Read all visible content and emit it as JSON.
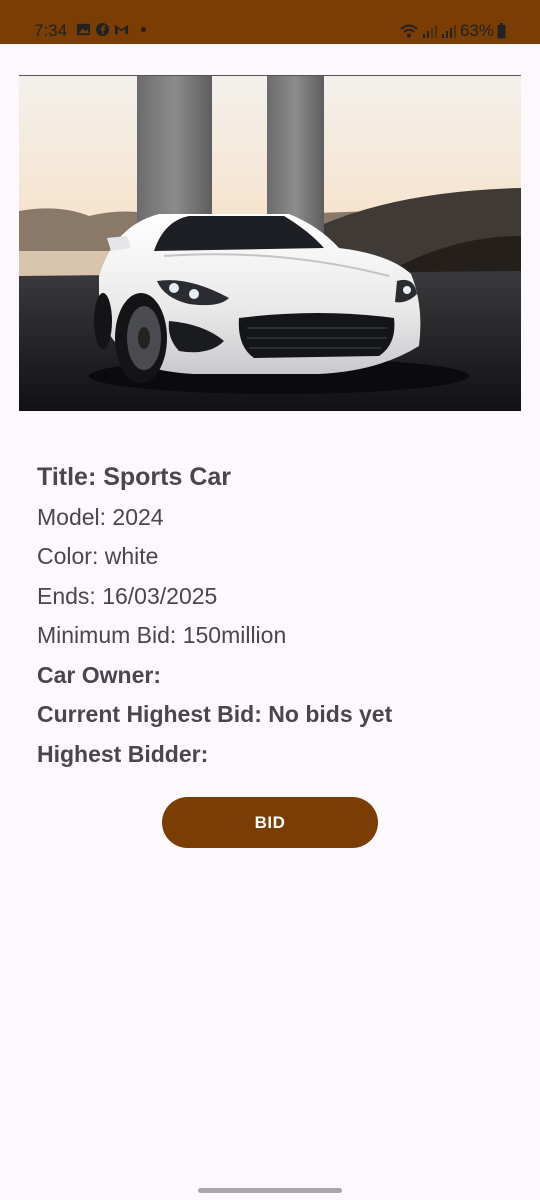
{
  "status_bar": {
    "time": "7:34",
    "left_icons": [
      "gallery-icon",
      "facebook-icon",
      "gmail-icon"
    ],
    "right_icons": [
      "wifi-icon",
      "signal-icon",
      "signal-icon",
      "battery-icon"
    ],
    "battery": "63%",
    "background": "#7a3e05"
  },
  "listing": {
    "image": "sports-car-photo",
    "title": "Title: Sports Car",
    "model": "Model: 2024",
    "color": "Color: white",
    "ends": "Ends: 16/03/2025",
    "minimum_bid": "Minimum Bid: 150million",
    "car_owner": "Car Owner:",
    "current_highest_bid": "Current Highest Bid: No bids yet",
    "highest_bidder": "Highest Bidder:"
  },
  "actions": {
    "bid_label": "BID",
    "bid_color": "#7a3e05"
  }
}
